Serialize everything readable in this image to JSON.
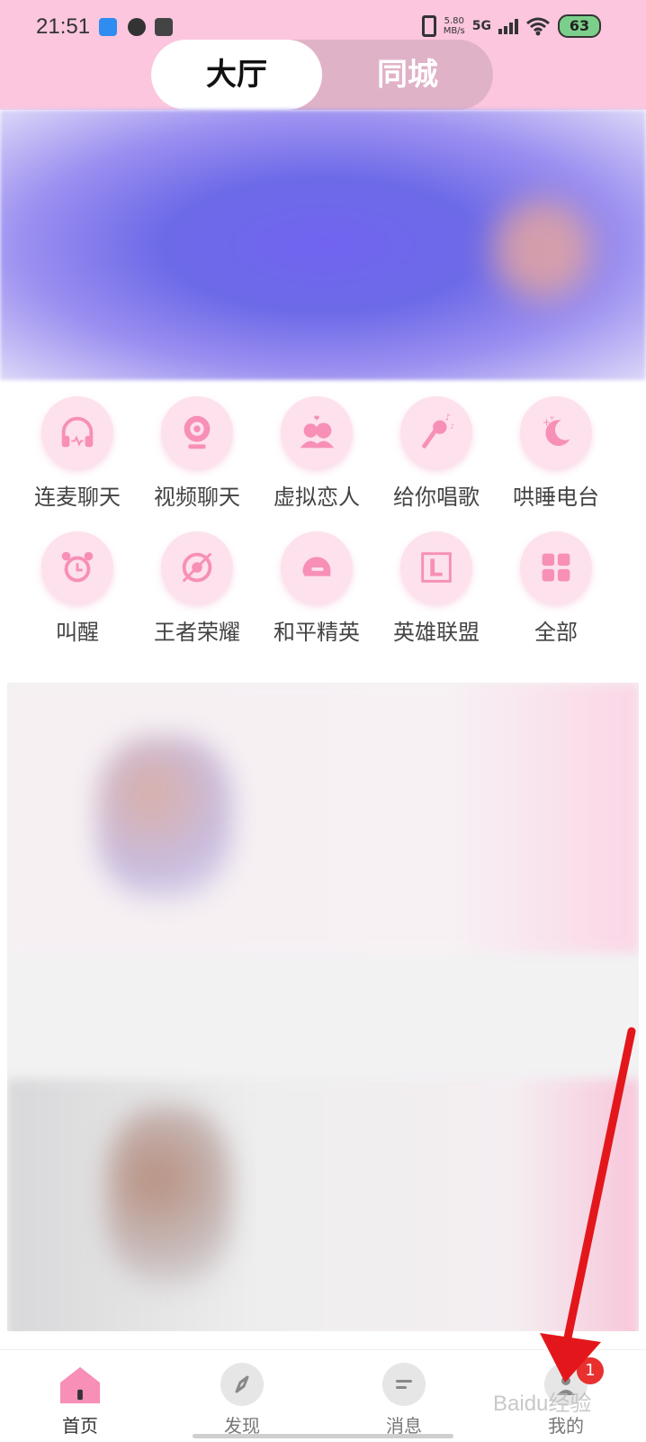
{
  "status_bar": {
    "time": "21:51",
    "net_speed_value": "5.80",
    "net_speed_unit": "MB/s",
    "network": "5G",
    "battery": "63"
  },
  "top_tabs": [
    {
      "label": "大厅",
      "active": true
    },
    {
      "label": "同城",
      "active": false
    }
  ],
  "categories": [
    {
      "label": "连麦聊天",
      "icon": "headphones-icon"
    },
    {
      "label": "视频聊天",
      "icon": "webcam-icon"
    },
    {
      "label": "虚拟恋人",
      "icon": "couple-icon"
    },
    {
      "label": "给你唱歌",
      "icon": "microphone-icon"
    },
    {
      "label": "哄睡电台",
      "icon": "moon-icon"
    },
    {
      "label": "叫醒",
      "icon": "alarm-clock-icon"
    },
    {
      "label": "王者荣耀",
      "icon": "honor-of-kings-icon"
    },
    {
      "label": "和平精英",
      "icon": "helmet-icon"
    },
    {
      "label": "英雄联盟",
      "icon": "league-icon"
    },
    {
      "label": "全部",
      "icon": "grid-icon"
    }
  ],
  "bottom_nav": [
    {
      "label": "首页",
      "icon": "home-icon",
      "active": true
    },
    {
      "label": "发现",
      "icon": "compass-icon",
      "active": false
    },
    {
      "label": "消息",
      "icon": "message-icon",
      "active": false
    },
    {
      "label": "我的",
      "icon": "profile-icon",
      "active": false,
      "badge": "1"
    }
  ],
  "watermark": "Baidu经验",
  "colors": {
    "header_bg": "#fbc6de",
    "accent_pink": "#f78fb7",
    "icon_circle": "#fde1ec",
    "badge": "#e8302e",
    "annotation_arrow": "#e3171b"
  }
}
